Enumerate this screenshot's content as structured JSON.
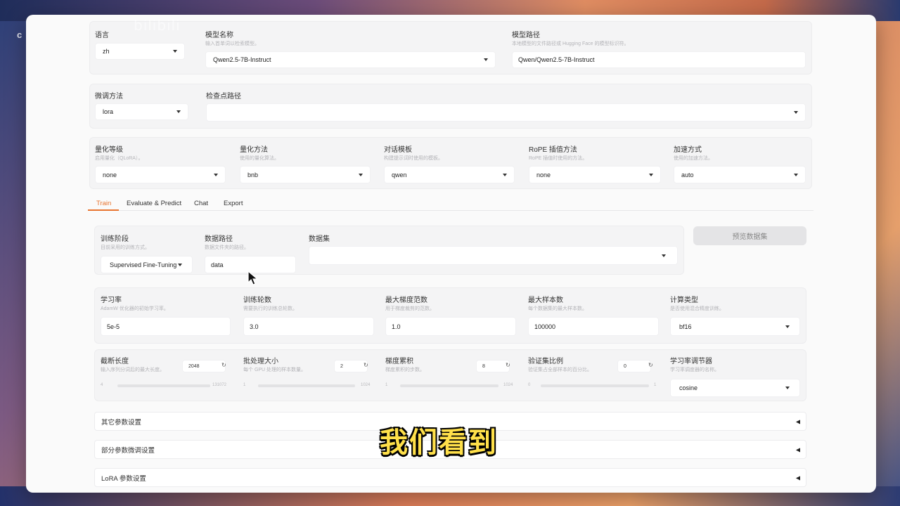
{
  "overlay": {
    "screen_label": "c",
    "watermark": "bilibili",
    "subtitle": "我们看到"
  },
  "top_row": {
    "lang": {
      "label": "语言",
      "value": "zh"
    },
    "model_name": {
      "label": "模型名称",
      "hint": "输入首单词以检索模型。",
      "value": "Qwen2.5-7B-Instruct"
    },
    "model_path": {
      "label": "模型路径",
      "hint": "本地模型的文件路径或 Hugging Face 的模型标识符。",
      "value": "Qwen/Qwen2.5-7B-Instruct"
    }
  },
  "second_row": {
    "finetune": {
      "label": "微调方法",
      "value": "lora"
    },
    "checkpoint": {
      "label": "检查点路径",
      "value": ""
    }
  },
  "third_row": {
    "quant_bit": {
      "label": "量化等级",
      "hint": "启用量化（QLoRA）。",
      "value": "none"
    },
    "quant_method": {
      "label": "量化方法",
      "hint": "使用的量化算法。",
      "value": "bnb"
    },
    "template": {
      "label": "对话模板",
      "hint": "构建提示词时使用的模板。",
      "value": "qwen"
    },
    "rope": {
      "label": "RoPE 插值方法",
      "hint": "RoPE 插值时使用的方法。",
      "value": "none"
    },
    "booster": {
      "label": "加速方式",
      "hint": "使用的加速方法。",
      "value": "auto"
    }
  },
  "tabs": [
    "Train",
    "Evaluate & Predict",
    "Chat",
    "Export"
  ],
  "train": {
    "stage": {
      "label": "训练阶段",
      "hint": "目前采用的训练方式。",
      "value": "Supervised Fine-Tuning"
    },
    "dataset_dir": {
      "label": "数据路径",
      "hint": "数据文件夹的路径。",
      "value": "data"
    },
    "dataset": {
      "label": "数据集",
      "value": ""
    },
    "preview_button": "预览数据集",
    "lr": {
      "label": "学习率",
      "hint": "AdamW 优化器的初始学习率。",
      "value": "5e-5"
    },
    "epochs": {
      "label": "训练轮数",
      "hint": "需要执行的训练总轮数。",
      "value": "3.0"
    },
    "max_grad_norm": {
      "label": "最大梯度范数",
      "hint": "用于梯度裁剪的范数。",
      "value": "1.0"
    },
    "max_samples": {
      "label": "最大样本数",
      "hint": "每个数据集的最大样本数。",
      "value": "100000"
    },
    "compute_type": {
      "label": "计算类型",
      "hint": "是否使用混合精度训练。",
      "value": "bf16"
    },
    "cutoff_len": {
      "label": "截断长度",
      "hint": "输入序列分词后的最大长度。",
      "value": "2048",
      "min": "4",
      "max": "131072"
    },
    "batch_size": {
      "label": "批处理大小",
      "hint": "每个 GPU 处理的样本数量。",
      "value": "2",
      "min": "1",
      "max": "1024"
    },
    "grad_accum": {
      "label": "梯度累积",
      "hint": "梯度累积的步数。",
      "value": "8",
      "min": "1",
      "max": "1024"
    },
    "val_size": {
      "label": "验证集比例",
      "hint": "验证集占全部样本的百分比。",
      "value": "0",
      "min": "0",
      "max": "1"
    },
    "scheduler": {
      "label": "学习率调节器",
      "hint": "学习率调度器的名称。",
      "value": "cosine"
    }
  },
  "accordions": [
    "其它参数设置",
    "部分参数微调设置",
    "LoRA 参数设置"
  ]
}
